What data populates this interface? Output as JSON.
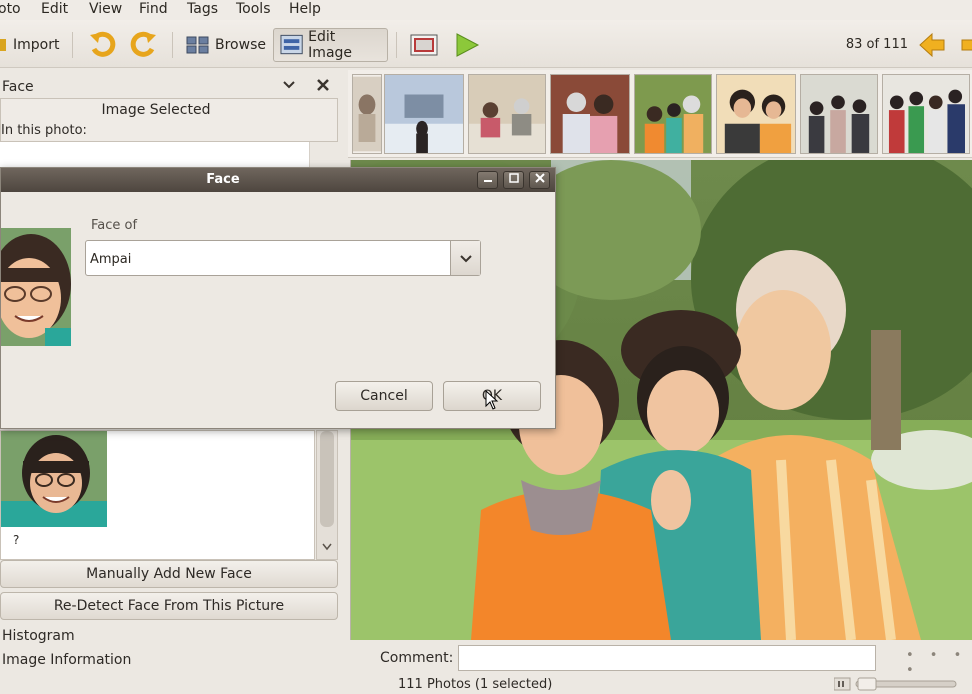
{
  "menu": [
    "oto",
    "Edit",
    "View",
    "Find",
    "Tags",
    "Tools",
    "Help"
  ],
  "toolbar": {
    "import_label": "Import",
    "browse_label": "Browse",
    "edit_image_label": "Edit Image",
    "counter": "83 of 111"
  },
  "left_panel": {
    "title": "Face",
    "image_selected": "Image Selected",
    "in_this_photo": "In this photo:",
    "face_name": "?",
    "manual_add_button": "Manually Add New Face",
    "redetect_button": "Re-Detect Face From This Picture",
    "histogram": "Histogram",
    "image_information": "Image Information"
  },
  "dialog": {
    "title": "Face",
    "face_of_label": "Face of",
    "face_of_value": "Ampai",
    "cancel_label": "Cancel",
    "ok_label": "OK"
  },
  "comment_label": "Comment:",
  "status": "111 Photos (1 selected)",
  "colors": {
    "window_bg": "#ece8e2",
    "title_bar": "#5a5148",
    "accent_yellow": "#f0b020"
  }
}
